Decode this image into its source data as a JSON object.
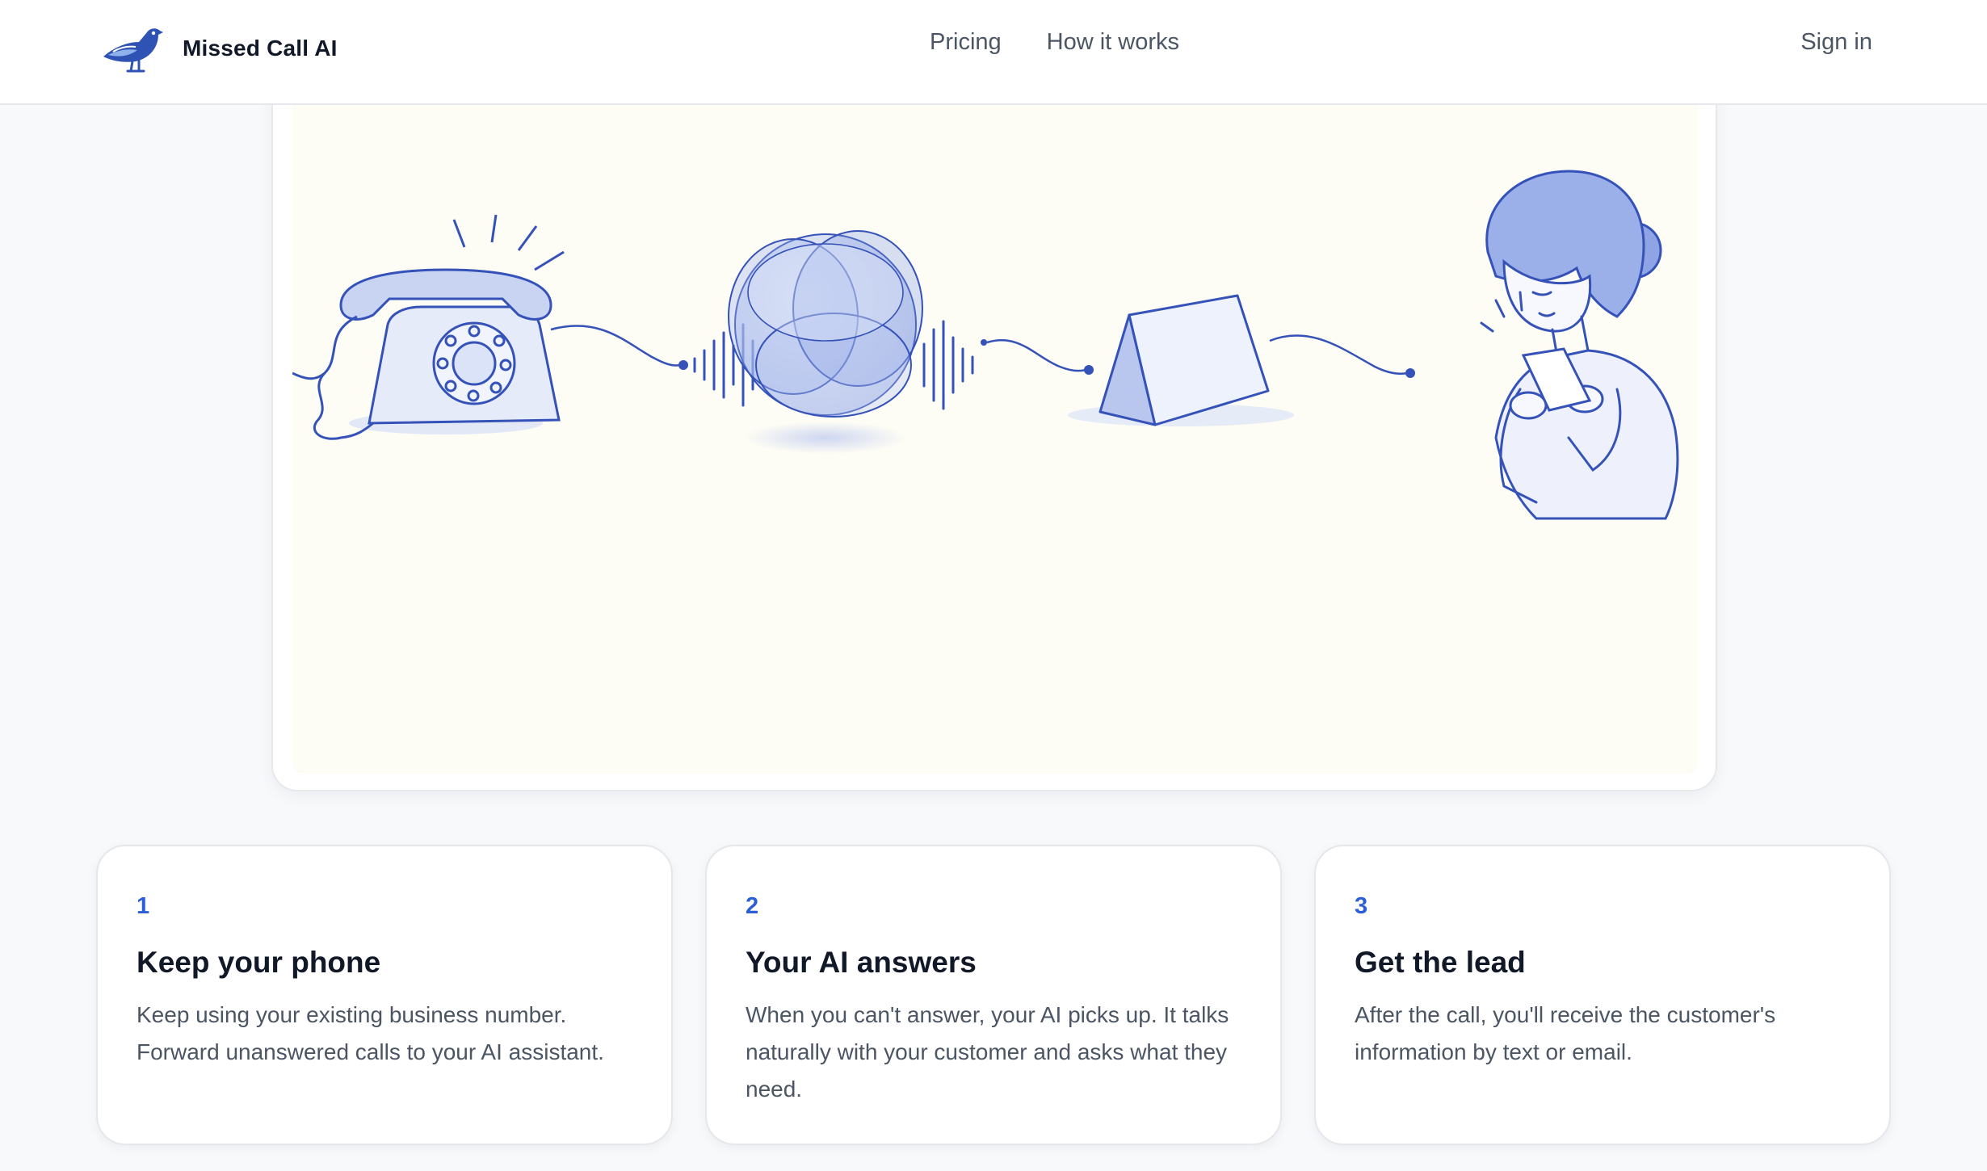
{
  "header": {
    "brand_name": "Missed Call AI",
    "nav": [
      {
        "label": "Pricing"
      },
      {
        "label": "How it works"
      }
    ],
    "sign_in_label": "Sign in"
  },
  "hero": {
    "illustration": "phone-to-ai-to-message-to-customer"
  },
  "steps": [
    {
      "number": "1",
      "title": "Keep your phone",
      "text": "Keep using your existing business number. Forward unanswered calls to your AI assistant."
    },
    {
      "number": "2",
      "title": "Your AI answers",
      "text": "When you can't answer, your AI picks up. It talks naturally with your customer and asks what they need."
    },
    {
      "number": "3",
      "title": "Get the lead",
      "text": "After the call, you'll receive the customer's information by text or email."
    }
  ],
  "colors": {
    "accent": "#2b5fd9",
    "sketch_blue": "#3552b8",
    "art_background": "#fdfcf5",
    "page_background": "#f8f9fb"
  }
}
